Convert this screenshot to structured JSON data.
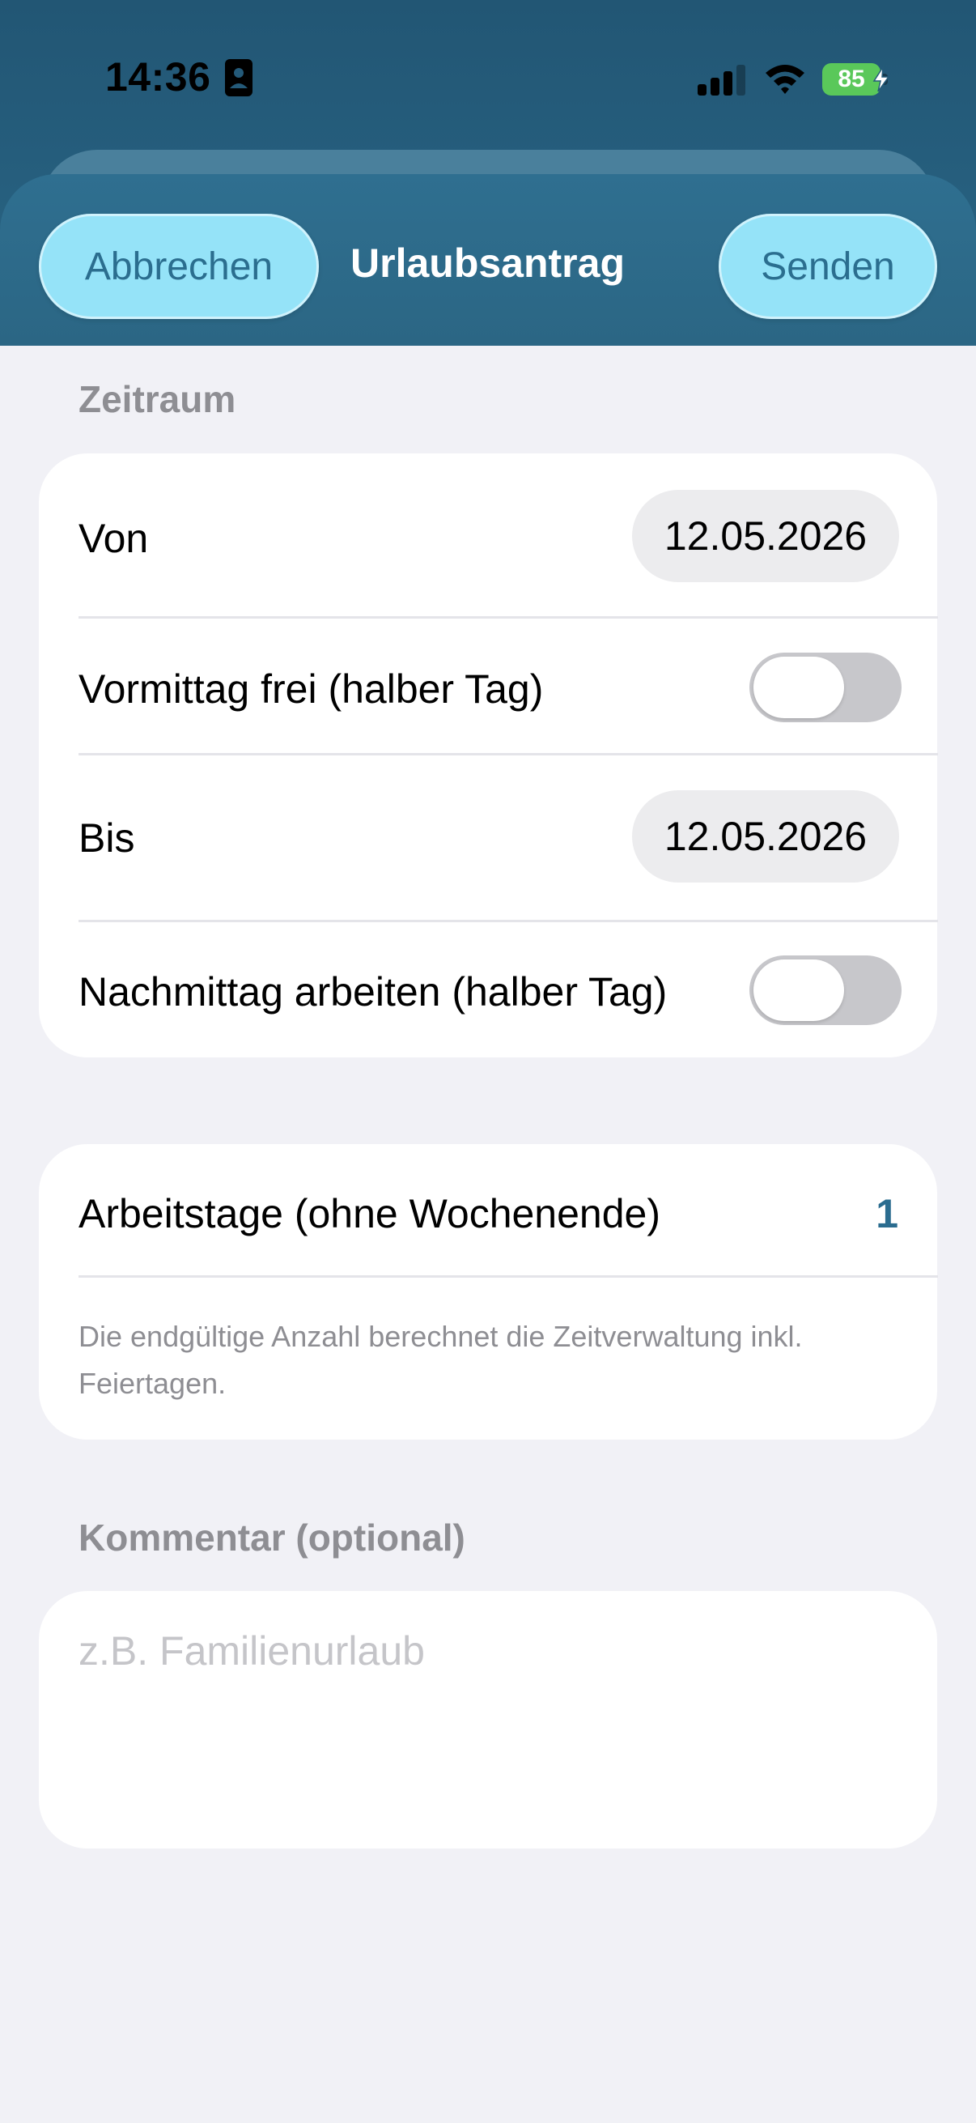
{
  "status_bar": {
    "time": "14:36",
    "battery_percent": "85",
    "signal_icon": "cellular-signal-icon",
    "wifi_icon": "wifi-icon",
    "colors": {
      "battery": "#5ac85a"
    }
  },
  "nav": {
    "cancel_label": "Abbrechen",
    "title": "Urlaubsantrag",
    "send_label": "Senden",
    "colors": {
      "header": "#245a79",
      "button": "#95e3f8",
      "button_text": "#2b6e8f"
    }
  },
  "period": {
    "section_title": "Zeitraum",
    "from": {
      "label": "Von",
      "value": "12.05.2026"
    },
    "morning_off": {
      "label": "Vormittag frei (halber Tag)",
      "on": false
    },
    "to": {
      "label": "Bis",
      "value": "12.05.2026"
    },
    "afternoon_work": {
      "label": "Nachmittag arbeiten (halber Tag)",
      "on": false
    }
  },
  "workdays": {
    "label": "Arbeitstage (ohne Wochenende)",
    "value": "1",
    "footnote": "Die endgültige Anzahl berechnet die Zeitverwaltung inkl. Feiertagen.",
    "accent_color": "#2a6c8f"
  },
  "comment": {
    "section_title": "Kommentar (optional)",
    "placeholder": "z.B. Familienurlaub",
    "value": ""
  }
}
